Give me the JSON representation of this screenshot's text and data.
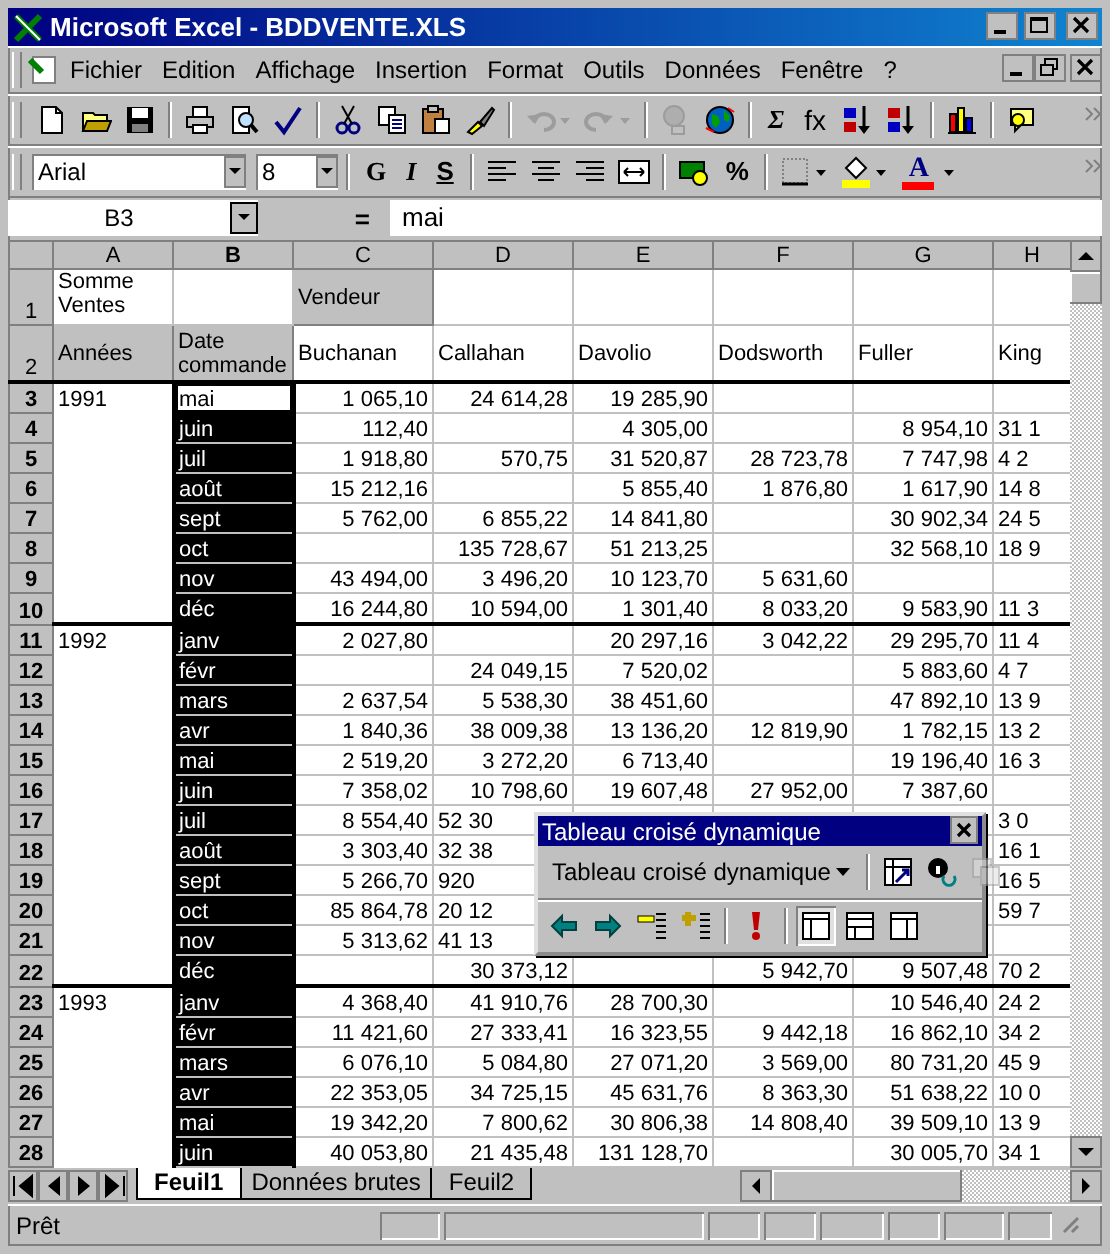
{
  "window": {
    "title": "Microsoft Excel - BDDVENTE.XLS"
  },
  "menu": [
    "Fichier",
    "Edition",
    "Affichage",
    "Insertion",
    "Format",
    "Outils",
    "Données",
    "Fenêtre",
    "?"
  ],
  "standard_toolbar": [
    {
      "kind": "icon",
      "disabled": false
    },
    {
      "kind": "icon",
      "disabled": false
    },
    {
      "kind": "icon",
      "disabled": false
    },
    {
      "kind": "sep"
    },
    {
      "kind": "icon",
      "disabled": false
    },
    {
      "kind": "icon",
      "disabled": false
    },
    {
      "kind": "icon",
      "disabled": false
    },
    {
      "kind": "sep"
    },
    {
      "kind": "icon",
      "disabled": false
    },
    {
      "kind": "icon",
      "disabled": false
    },
    {
      "kind": "icon",
      "disabled": false
    },
    {
      "kind": "icon",
      "disabled": false
    },
    {
      "kind": "sep"
    },
    {
      "kind": "icon",
      "disabled": true
    },
    {
      "kind": "icon",
      "disabled": true
    },
    {
      "kind": "sep"
    },
    {
      "kind": "icon",
      "disabled": true
    },
    {
      "kind": "icon",
      "disabled": false
    },
    {
      "kind": "sep"
    },
    {
      "kind": "text",
      "label": "Σ"
    },
    {
      "kind": "text",
      "label": "fx"
    },
    {
      "kind": "icon",
      "disabled": false
    },
    {
      "kind": "icon",
      "disabled": false
    },
    {
      "kind": "sep"
    },
    {
      "kind": "icon",
      "disabled": false
    },
    {
      "kind": "sep"
    },
    {
      "kind": "icon",
      "disabled": false
    }
  ],
  "formatting_toolbar": {
    "font": "Arial",
    "size": "8",
    "bold": "G",
    "italic": "I",
    "underline": "S",
    "percent": "%",
    "font_color": "A"
  },
  "formula_bar": {
    "name_box": "B3",
    "equals": "=",
    "value": "mai"
  },
  "columns": [
    {
      "label": "A",
      "selected": false
    },
    {
      "label": "B",
      "selected": true
    },
    {
      "label": "C",
      "selected": false
    },
    {
      "label": "D",
      "selected": false
    },
    {
      "label": "E",
      "selected": false
    },
    {
      "label": "F",
      "selected": false
    },
    {
      "label": "G",
      "selected": false
    },
    {
      "label": "H",
      "selected": false
    }
  ],
  "header_rows": {
    "row1": {
      "label": "1",
      "a": "Somme Ventes",
      "c": "Vendeur"
    },
    "row2": {
      "label": "2",
      "a": "Années",
      "b": "Date commande",
      "sellers": [
        "Buchanan",
        "Callahan",
        "Davolio",
        "Dodsworth",
        "Fuller",
        "King"
      ]
    }
  },
  "rows": [
    {
      "label": "3",
      "year": "1991",
      "month": "mai",
      "selected": true,
      "active": true,
      "cells": [
        "1 065,10",
        "24 614,28",
        "19 285,90",
        null,
        null,
        null
      ]
    },
    {
      "label": "4",
      "month": "juin",
      "selected": true,
      "active": false,
      "cells": [
        "112,40",
        null,
        "4 305,00",
        null,
        "8 954,10",
        "31 1"
      ]
    },
    {
      "label": "5",
      "month": "juil",
      "selected": true,
      "active": false,
      "cells": [
        "1 918,80",
        "570,75",
        "31 520,87",
        "28 723,78",
        "7 747,98",
        "4 2"
      ]
    },
    {
      "label": "6",
      "month": "août",
      "selected": true,
      "active": false,
      "cells": [
        "15 212,16",
        null,
        "5 855,40",
        "1 876,80",
        "1 617,90",
        "14 8"
      ]
    },
    {
      "label": "7",
      "month": "sept",
      "selected": true,
      "active": false,
      "cells": [
        "5 762,00",
        "6 855,22",
        "14 841,80",
        null,
        "30 902,34",
        "24 5"
      ]
    },
    {
      "label": "8",
      "month": "oct",
      "selected": true,
      "active": false,
      "cells": [
        null,
        "135 728,67",
        "51 213,25",
        null,
        "32 568,10",
        "18 9"
      ]
    },
    {
      "label": "9",
      "month": "nov",
      "selected": true,
      "active": false,
      "cells": [
        "43 494,00",
        "3 496,20",
        "10 123,70",
        "5 631,60",
        null,
        null
      ]
    },
    {
      "label": "10",
      "month": "déc",
      "selected": true,
      "active": false,
      "cells": [
        "16 244,80",
        "10 594,00",
        "1 301,40",
        "8 033,20",
        "9 583,90",
        "11 3"
      ]
    },
    {
      "label": "11",
      "year": "1992",
      "month": "janv",
      "selected": true,
      "active": false,
      "cells": [
        "2 027,80",
        null,
        "20 297,16",
        "3 042,22",
        "29 295,70",
        "11 4"
      ]
    },
    {
      "label": "12",
      "month": "févr",
      "selected": true,
      "active": false,
      "cells": [
        null,
        "24 049,15",
        "7 520,02",
        null,
        "5 883,60",
        "4 7"
      ]
    },
    {
      "label": "13",
      "month": "mars",
      "selected": true,
      "active": false,
      "cells": [
        "2 637,54",
        "5 538,30",
        "38 451,60",
        null,
        "47 892,10",
        "13 9"
      ]
    },
    {
      "label": "14",
      "month": "avr",
      "selected": true,
      "active": false,
      "cells": [
        "1 840,36",
        "38 009,38",
        "13 136,20",
        "12 819,90",
        "1 782,15",
        "13 2"
      ]
    },
    {
      "label": "15",
      "month": "mai",
      "selected": true,
      "active": false,
      "cells": [
        "2 519,20",
        "3 272,20",
        "6 713,40",
        null,
        "19 196,40",
        "16 3"
      ]
    },
    {
      "label": "16",
      "month": "juin",
      "selected": true,
      "active": false,
      "cells": [
        "7 358,02",
        "10 798,60",
        "19 607,48",
        "27 952,00",
        "7 387,60",
        null
      ]
    },
    {
      "label": "17",
      "month": "juil",
      "selected": true,
      "active": false,
      "cells": [
        "8 554,40",
        {
          "text": "52 30",
          "kind": "cut"
        },
        null,
        null,
        null,
        "3 0"
      ]
    },
    {
      "label": "18",
      "month": "août",
      "selected": true,
      "active": false,
      "cells": [
        "3 303,40",
        {
          "text": "32 38",
          "kind": "cut"
        },
        null,
        null,
        null,
        "16 1"
      ]
    },
    {
      "label": "19",
      "month": "sept",
      "selected": true,
      "active": false,
      "cells": [
        "5 266,70",
        {
          "text": "920",
          "kind": "cut"
        },
        null,
        null,
        null,
        "16 5"
      ]
    },
    {
      "label": "20",
      "month": "oct",
      "selected": true,
      "active": false,
      "cells": [
        "85 864,78",
        {
          "text": "20 12",
          "kind": "cut"
        },
        null,
        null,
        null,
        "59 7"
      ]
    },
    {
      "label": "21",
      "month": "nov",
      "selected": true,
      "active": false,
      "cells": [
        "5 313,62",
        {
          "text": "41 13",
          "kind": "cut"
        },
        null,
        null,
        null,
        null
      ]
    },
    {
      "label": "22",
      "month": "déc",
      "selected": true,
      "active": false,
      "cells": [
        null,
        "30 373,12",
        null,
        "5 942,70",
        "9 507,48",
        "70 2"
      ]
    },
    {
      "label": "23",
      "year": "1993",
      "month": "janv",
      "selected": true,
      "active": false,
      "cells": [
        "4 368,40",
        "41 910,76",
        "28 700,30",
        null,
        "10 546,40",
        "24 2"
      ]
    },
    {
      "label": "24",
      "month": "févr",
      "selected": true,
      "active": false,
      "cells": [
        "11 421,60",
        "27 333,41",
        "16 323,55",
        "9 442,18",
        "16 862,10",
        "34 2"
      ]
    },
    {
      "label": "25",
      "month": "mars",
      "selected": true,
      "active": false,
      "cells": [
        "6 076,10",
        "5 084,80",
        "27 071,20",
        "3 569,00",
        "80 731,20",
        "45 9"
      ]
    },
    {
      "label": "26",
      "month": "avr",
      "selected": true,
      "active": false,
      "cells": [
        "22 353,05",
        "34 725,15",
        "45 631,76",
        "8 363,30",
        "51 638,22",
        "10 0"
      ]
    },
    {
      "label": "27",
      "month": "mai",
      "selected": true,
      "active": false,
      "cells": [
        "19 342,20",
        "7 800,62",
        "30 806,38",
        "14 808,40",
        "39 509,10",
        "13 9"
      ]
    },
    {
      "label": "28",
      "month": "juin",
      "selected": true,
      "active": false,
      "cells": [
        "40 053,80",
        "21 435,48",
        "131 128,70",
        null,
        "30 005,70",
        "34 1"
      ]
    }
  ],
  "pivot_toolbar": {
    "title": "Tableau croisé dynamique",
    "menu": "Tableau croisé dynamique",
    "buttons": [
      {
        "disabled": false,
        "pressed": false
      },
      {
        "disabled": false,
        "pressed": false
      },
      {
        "disabled": true,
        "pressed": false
      },
      {
        "disabled": false,
        "pressed": false
      },
      {
        "disabled": false,
        "pressed": false
      },
      {
        "disabled": false,
        "pressed": false
      },
      {
        "disabled": false,
        "pressed": false
      },
      {
        "disabled": false,
        "pressed": false
      },
      {
        "disabled": false,
        "pressed": true
      },
      {
        "disabled": false,
        "pressed": false
      },
      {
        "disabled": false,
        "pressed": false
      }
    ]
  },
  "sheet_tabs": [
    {
      "label": "Feuil1",
      "selected": true
    },
    {
      "label": "Données brutes",
      "selected": false
    },
    {
      "label": "Feuil2",
      "selected": false
    }
  ],
  "status_bar": {
    "text": "Prêt"
  }
}
